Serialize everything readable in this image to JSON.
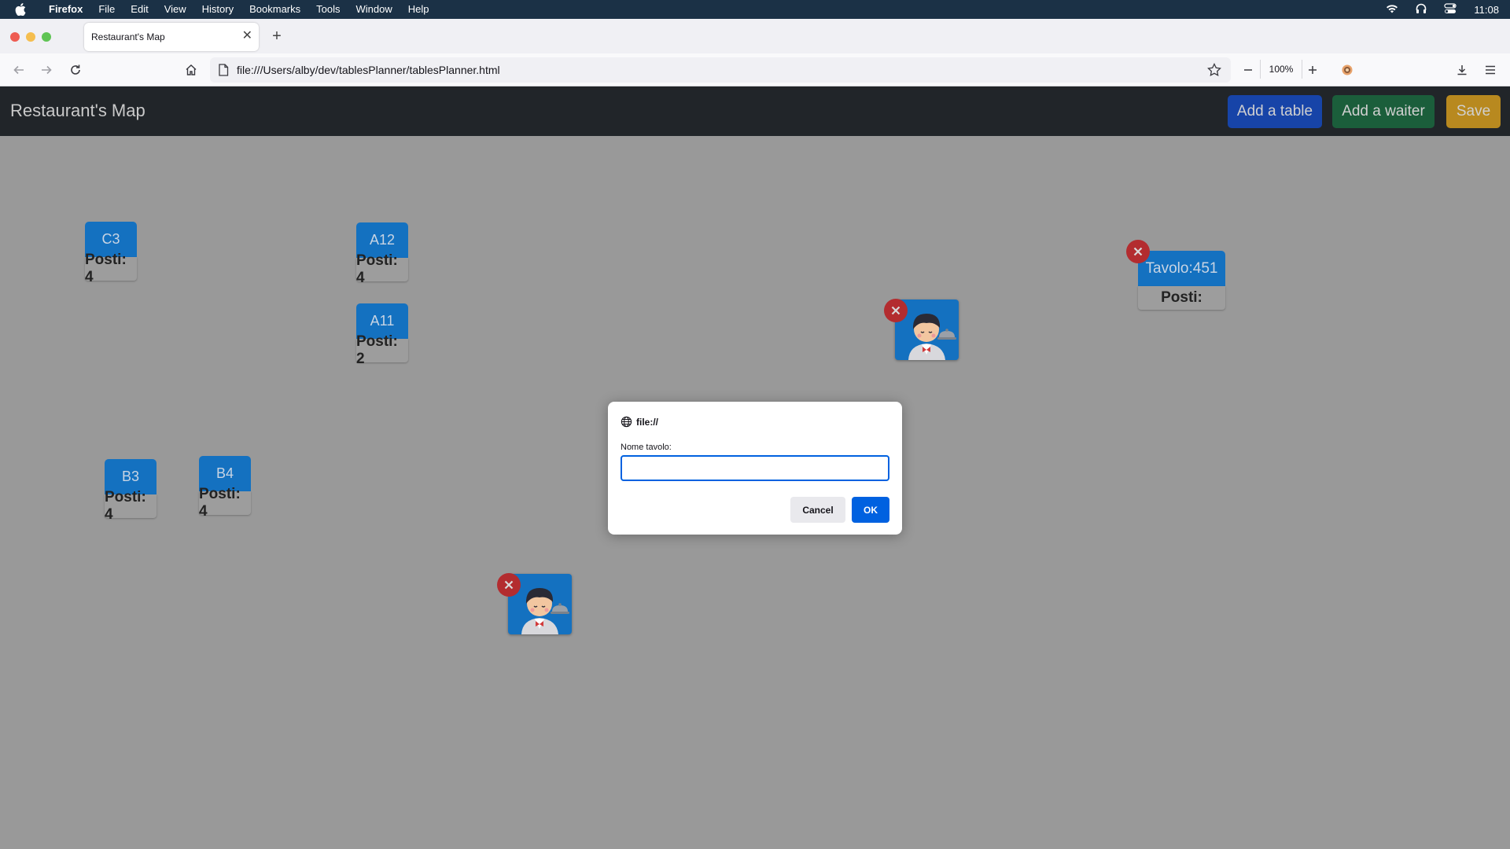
{
  "menubar": {
    "app": "Firefox",
    "items": [
      "File",
      "Edit",
      "View",
      "History",
      "Bookmarks",
      "Tools",
      "Window",
      "Help"
    ],
    "clock": "11:08"
  },
  "browser": {
    "tab_title": "Restaurant's Map",
    "url": "file:///Users/alby/dev/tablesPlanner/tablesPlanner.html",
    "zoom": "100%"
  },
  "app": {
    "brand": "Restaurant's Map",
    "add_table_label": "Add a table",
    "add_waiter_label": "Add a waiter",
    "save_label": "Save",
    "colors": {
      "add_table": "#1744a8",
      "add_waiter": "#1b5e3b",
      "save": "#b8891f",
      "table": "#1471c0",
      "delete": "#b32c2f"
    }
  },
  "tables": [
    {
      "name": "C3",
      "seats": "Posti: 4"
    },
    {
      "name": "A12",
      "seats": "Posti: 4"
    },
    {
      "name": "A11",
      "seats": "Posti: 2"
    },
    {
      "name": "B3",
      "seats": "Posti: 4"
    },
    {
      "name": "B4",
      "seats": "Posti: 4"
    },
    {
      "name": "Tavolo:451",
      "seats": "Posti:"
    }
  ],
  "dialog": {
    "origin": "file://",
    "prompt": "Nome tavolo:",
    "input_value": "",
    "cancel_label": "Cancel",
    "ok_label": "OK"
  }
}
